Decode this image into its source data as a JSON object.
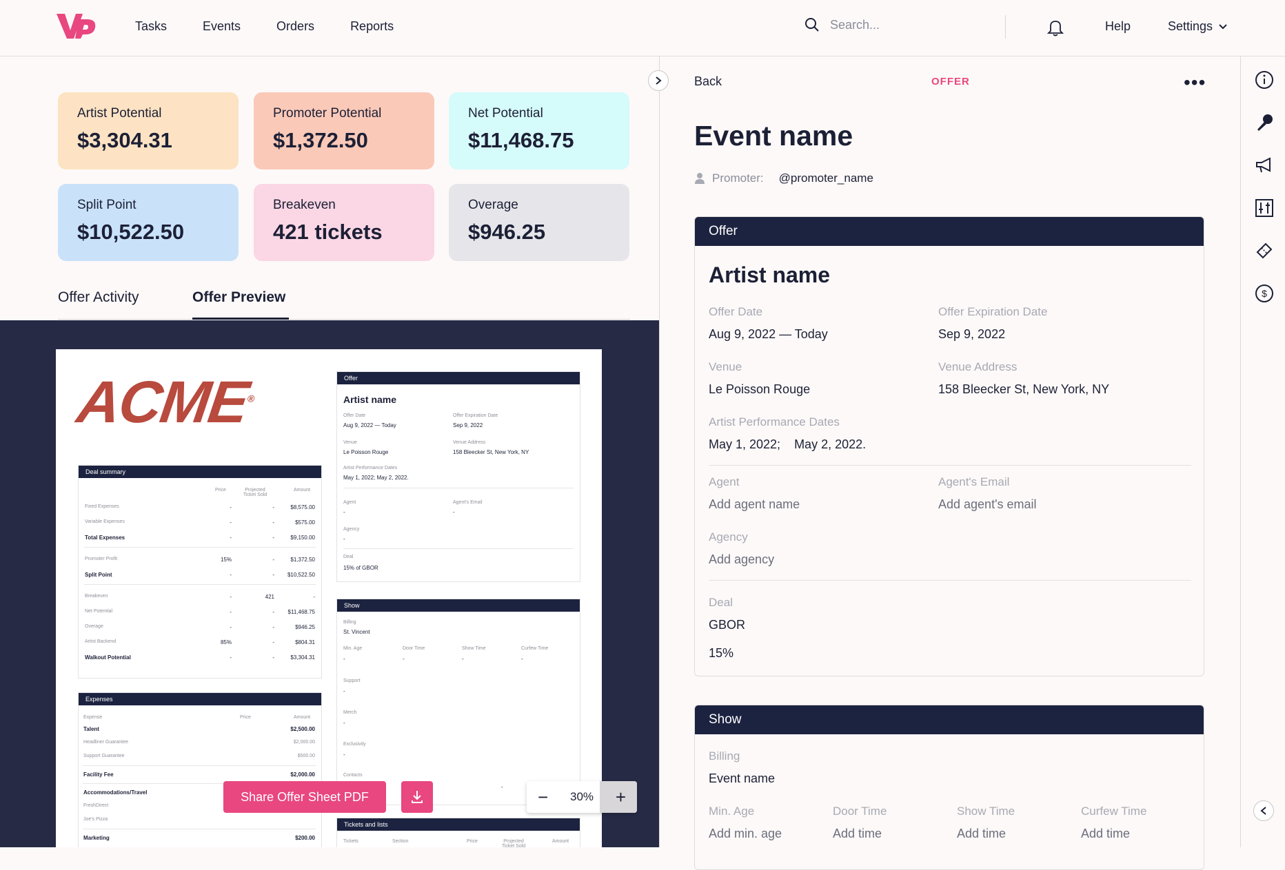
{
  "nav": {
    "items": [
      "Tasks",
      "Events",
      "Orders",
      "Reports"
    ]
  },
  "search": {
    "placeholder": "Search..."
  },
  "header": {
    "help": "Help",
    "settings": "Settings"
  },
  "metrics": [
    {
      "label": "Artist Potential",
      "value": "$3,304.31",
      "color": "#fde3c3"
    },
    {
      "label": "Promoter Potential",
      "value": "$1,372.50",
      "color": "#fbc9b8"
    },
    {
      "label": "Net Potential",
      "value": "$11,468.75",
      "color": "#d6fbfb"
    },
    {
      "label": "Split Point",
      "value": "$10,522.50",
      "color": "#c9e2fa"
    },
    {
      "label": "Breakeven",
      "value": "421 tickets",
      "color": "#fbd6e4"
    },
    {
      "label": "Overage",
      "value": "$946.25",
      "color": "#e6e6ea"
    }
  ],
  "tabs": [
    {
      "label": "Offer Activity"
    },
    {
      "label": "Offer Preview"
    }
  ],
  "preview": {
    "logo": "ACME",
    "deal_summary": {
      "title": "Deal summary",
      "headers": [
        "Price",
        "Projected Ticket Sold",
        "Amount"
      ],
      "rows": [
        [
          "Fixed Expenses",
          "-",
          "-",
          "$8,575.00"
        ],
        [
          "Variable Expenses",
          "-",
          "-",
          "$575.00"
        ],
        [
          "Total Expenses",
          "-",
          "-",
          "$9,150.00"
        ],
        [
          "Promoter Profit",
          "15%",
          "-",
          "$1,372.50"
        ],
        [
          "Split Point",
          "-",
          "-",
          "$10,522.50"
        ],
        [
          "Breakeven",
          "-",
          "421",
          "-"
        ],
        [
          "Net Potential",
          "-",
          "-",
          "$11,468.75"
        ],
        [
          "Overage",
          "-",
          "-",
          "$946.25"
        ],
        [
          "Artist Backend",
          "85%",
          "-",
          "$804.31"
        ],
        [
          "Walkout Potential",
          "-",
          "-",
          "$3,304.31"
        ]
      ]
    },
    "expenses": {
      "title": "Expenses",
      "headers": [
        "Expense",
        "Price",
        "Amount"
      ],
      "rows": [
        [
          "Talent",
          "",
          "$2,500.00"
        ],
        [
          "Headliner Guarantee",
          "",
          "$2,000.00"
        ],
        [
          "Support Guarantee",
          "",
          "$500.00"
        ],
        [
          "Facility Fee",
          "",
          "$2,000.00"
        ],
        [
          "Accommodations/Travel",
          "",
          ""
        ],
        [
          "FreshDirect",
          "",
          ""
        ],
        [
          "Joe's Pizza",
          "",
          ""
        ],
        [
          "Marketing",
          "",
          "$200.00"
        ]
      ]
    },
    "offer": {
      "title": "Offer",
      "artist": "Artist name",
      "offer_date_l": "Offer Date",
      "offer_date": "Aug 9, 2022 — Today",
      "exp_l": "Offer Expiration Date",
      "exp": "Sep 9, 2022",
      "venue_l": "Venue",
      "venue": "Le Poisson Rouge",
      "addr_l": "Venue Address",
      "addr": "158 Bleecker St, New York, NY",
      "perf_l": "Artist Performance Dates",
      "perf": "May 1, 2022;   May 2, 2022.",
      "agent_l": "Agent",
      "agent": "-",
      "email_l": "Agent's Email",
      "email": "-",
      "agency_l": "Agency",
      "agency": "-",
      "deal_l": "Deal",
      "deal": "15% of GBOR"
    },
    "show": {
      "title": "Show",
      "billing_l": "Billing",
      "billing": "St. Vincent",
      "minage_l": "Min. Age",
      "door_l": "Door Time",
      "showt_l": "Show Time",
      "curfew_l": "Curfew Time",
      "dash": "-",
      "support_l": "Support",
      "merch_l": "Merch",
      "excl_l": "Exclusivity",
      "contacts_l": "Contacts"
    },
    "tickets": {
      "title": "Tickets and lists",
      "headers": [
        "Tickets",
        "Section",
        "Price",
        "Projected Ticket Sold",
        "Amount"
      ]
    }
  },
  "actions": {
    "share": "Share Offer Sheet PDF",
    "zoom": "30%",
    "zoom_minus": "−",
    "zoom_plus": "+"
  },
  "detail": {
    "back": "Back",
    "tag": "OFFER",
    "more": "•••",
    "event_name": "Event name",
    "promoter_label": "Promoter:",
    "promoter": "@promoter_name",
    "offer": {
      "title": "Offer",
      "artist": "Artist name",
      "offer_date_l": "Offer Date",
      "offer_date": "Aug 9, 2022 — Today",
      "exp_l": "Offer Expiration Date",
      "exp": "Sep 9, 2022",
      "venue_l": "Venue",
      "venue": "Le Poisson Rouge",
      "addr_l": "Venue Address",
      "addr": "158 Bleecker St, New York, NY",
      "perf_l": "Artist Performance Dates",
      "perf": "May 1, 2022;    May 2, 2022.",
      "agent_l": "Agent",
      "agent": "Add agent name",
      "email_l": "Agent's Email",
      "email": "Add agent's email",
      "agency_l": "Agency",
      "agency": "Add agency",
      "deal_l": "Deal",
      "deal": "GBOR",
      "deal_pct": "15%"
    },
    "show": {
      "title": "Show",
      "billing_l": "Billing",
      "billing": "Event name",
      "minage_l": "Min. Age",
      "minage": "Add min. age",
      "door_l": "Door Time",
      "door": "Add time",
      "showt_l": "Show Time",
      "showt": "Add time",
      "curfew_l": "Curfew Time",
      "curfew": "Add time"
    }
  },
  "accent": "#e8477f",
  "navy": "#1c2340"
}
